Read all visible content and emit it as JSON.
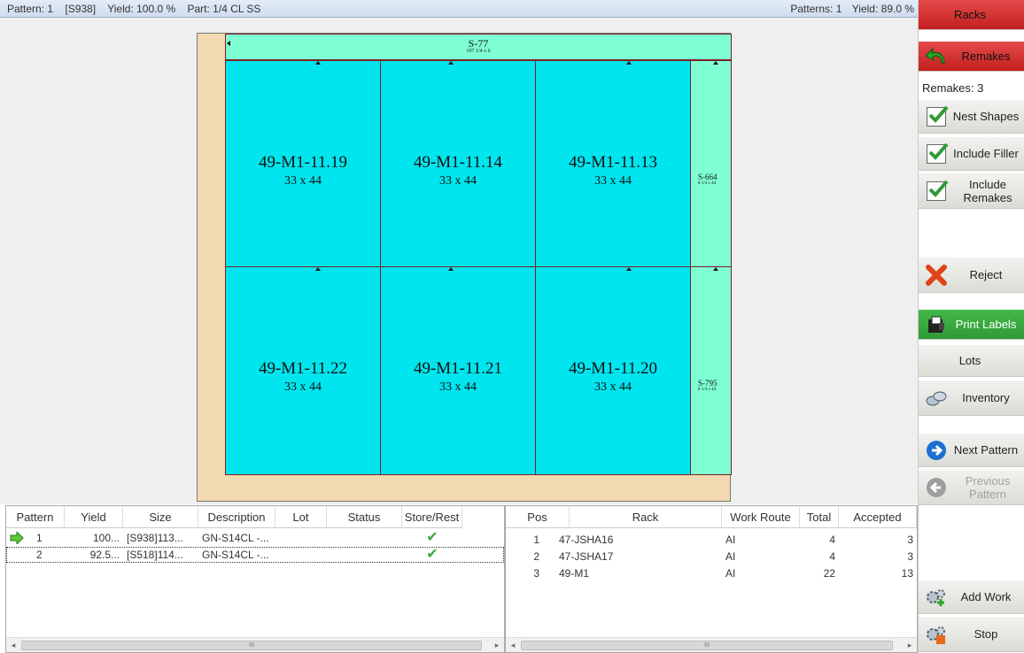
{
  "status": {
    "pattern": "Pattern: 1",
    "code": "[S938]",
    "yield": "Yield: 100.0 %",
    "part": "Part: 1/4 CL SS",
    "patterns_count": "Patterns: 1",
    "total_yield": "Yield: 89.0 %"
  },
  "sheet": {
    "top_filler": {
      "name": "S-77",
      "dims": "107 1/4 x 6"
    },
    "right_filler_top": {
      "name": "S-664",
      "dims": "8 1/4 x 44"
    },
    "right_filler_bottom": {
      "name": "S-795",
      "dims": "8 1/4 x 44"
    },
    "pieces": [
      {
        "name": "49-M1-11.19",
        "dims": "33 x 44"
      },
      {
        "name": "49-M1-11.14",
        "dims": "33 x 44"
      },
      {
        "name": "49-M1-11.13",
        "dims": "33 x 44"
      },
      {
        "name": "49-M1-11.22",
        "dims": "33 x 44"
      },
      {
        "name": "49-M1-11.21",
        "dims": "33 x 44"
      },
      {
        "name": "49-M1-11.20",
        "dims": "33 x 44"
      }
    ]
  },
  "sidebar": {
    "racks": "Racks",
    "remakes": "Remakes",
    "remakes_count": "Remakes: 3",
    "nest_shapes": "Nest Shapes",
    "include_filler": "Include Filler",
    "include_remakes": "Include Remakes",
    "reject": "Reject",
    "print_labels": "Print Labels",
    "lots": "Lots",
    "inventory": "Inventory",
    "next_pattern": "Next Pattern",
    "previous_pattern": "Previous Pattern",
    "add_work": "Add Work",
    "stop": "Stop"
  },
  "patterns_table": {
    "columns": [
      "Pattern",
      "Yield",
      "Size",
      "Description",
      "Lot",
      "Status",
      "Store/Rest"
    ],
    "rows": [
      {
        "pattern": "1",
        "yield": "100...",
        "size": "[S938]113...",
        "description": "GN-S14CL -...",
        "lot": "",
        "status": "",
        "store": "✔"
      },
      {
        "pattern": "2",
        "yield": "92.5...",
        "size": "[S518]114...",
        "description": "GN-S14CL -...",
        "lot": "",
        "status": "",
        "store": "✔"
      }
    ]
  },
  "racks_table": {
    "columns": [
      "Pos",
      "Rack",
      "Work Route",
      "Total",
      "Accepted"
    ],
    "rows": [
      {
        "pos": "1",
        "rack": "47-JSHA16",
        "route": "AI",
        "total": "4",
        "accepted": "3"
      },
      {
        "pos": "2",
        "rack": "47-JSHA17",
        "route": "AI",
        "total": "4",
        "accepted": "3"
      },
      {
        "pos": "3",
        "rack": "49-M1",
        "route": "AI",
        "total": "22",
        "accepted": "13"
      }
    ]
  },
  "scroll_grip": "III",
  "colors": {
    "piece": "#00e5ee",
    "filler": "#7fffd4",
    "sheet": "#f3d9b1",
    "red_button": "#d32f2f",
    "green_button": "#3aa840"
  }
}
